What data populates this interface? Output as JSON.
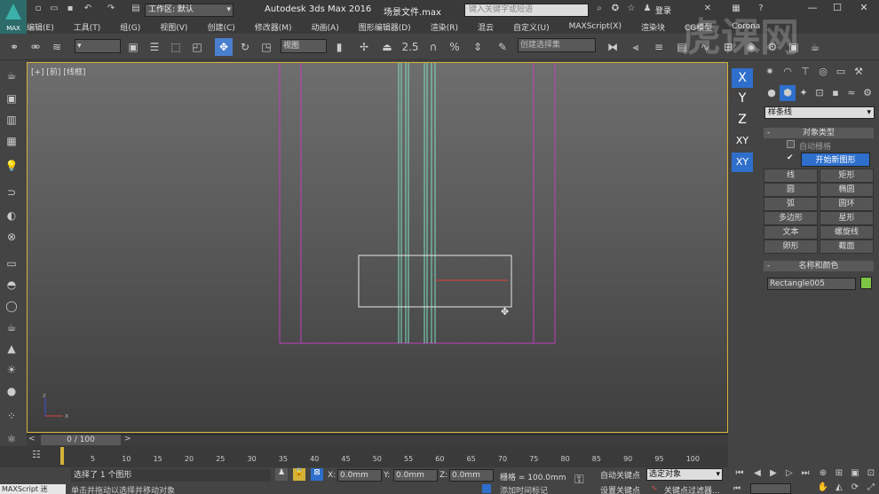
{
  "app_title": "Autodesk 3ds Max 2016",
  "scene_file": "场景文件.max",
  "workspace_label": "工作区: 默认",
  "search_placeholder": "键入关键字或短语",
  "login_label": "登录",
  "watermark_text": "虎课网",
  "menu": [
    "编辑(E)",
    "工具(T)",
    "组(G)",
    "视图(V)",
    "创建(C)",
    "修改器(M)",
    "动画(A)",
    "图形编辑器(D)",
    "渲染(R)",
    "混云",
    "自定义(U)",
    "MAXScript(X)",
    "渲染块",
    "CG模型",
    "Corona"
  ],
  "toolbar": {
    "ref_coord": "视图",
    "snap_angle": "2.5",
    "snap_percent": "%",
    "selection_set": "创建选择集"
  },
  "viewport": {
    "label": "[+] [前] [线框]",
    "axis_x": "x",
    "axis_z": "z"
  },
  "axis_buttons": [
    "X",
    "Y",
    "Z",
    "XY",
    "XY"
  ],
  "command_panel": {
    "category": "样条线",
    "object_type_title": "对象类型",
    "auto_grid": "自动栅格",
    "start_new_shape": "开始新图形",
    "objects": [
      "线",
      "矩形",
      "圆",
      "椭圆",
      "弧",
      "圆环",
      "多边形",
      "星形",
      "文本",
      "螺旋线",
      "卵形",
      "截面"
    ],
    "name_color_title": "名称和颜色",
    "object_name": "Rectangle005",
    "object_color": "#7ec446"
  },
  "timeline": {
    "range": "0 / 100",
    "ticks": [
      "5",
      "10",
      "15",
      "20",
      "25",
      "30",
      "35",
      "40",
      "45",
      "50",
      "55",
      "60",
      "65",
      "70",
      "75",
      "80",
      "85",
      "90",
      "95",
      "100"
    ]
  },
  "status": {
    "maxscript_label": "MAXScript 迷",
    "selected_text": "选择了 1 个图形",
    "hint_text": "单击并拖动以选择并移动对象",
    "x_label": "X:",
    "x_value": "0.0mm",
    "y_label": "Y:",
    "y_value": "0.0mm",
    "z_label": "Z:",
    "z_value": "0.0mm",
    "grid_text": "栅格 = 100.0mm",
    "add_time_tag": "添加时间标记",
    "auto_key": "自动关键点",
    "set_key": "设置关键点",
    "selected_object": "选定对象",
    "key_filters": "关键点过滤器..."
  }
}
